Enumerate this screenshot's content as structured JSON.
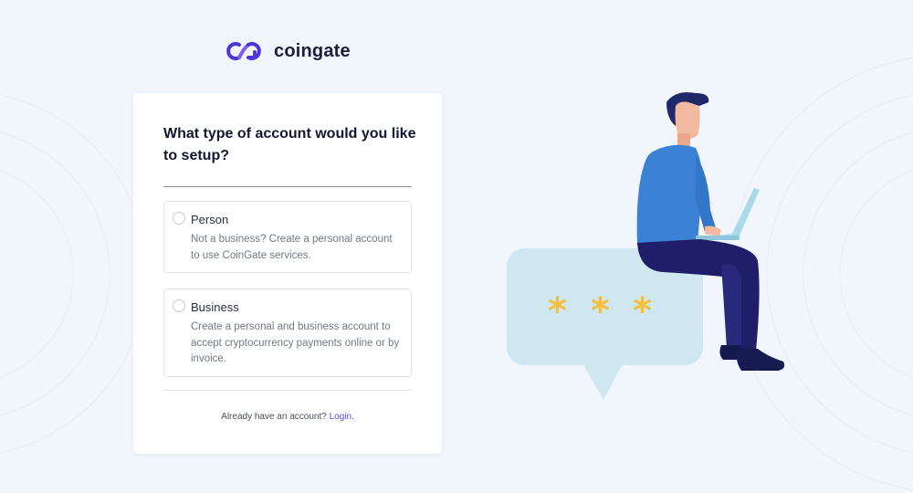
{
  "brand": {
    "name": "coingate",
    "accent_color": "#5b4fd1"
  },
  "card": {
    "title": "What type of account would you like to setup?",
    "options": [
      {
        "label": "Person",
        "description": "Not a business? Create a personal account to use CoinGate services.",
        "selected": false
      },
      {
        "label": "Business",
        "description": "Create a personal and business account to accept cryptocurrency payments online or by invoice.",
        "selected": false
      }
    ],
    "login_prompt": "Already have an account?",
    "login_link": "Login",
    "login_suffix": "."
  },
  "illustration": {
    "subject": "person-with-laptop-on-speech-bubble",
    "bubble_text": "* * *"
  }
}
